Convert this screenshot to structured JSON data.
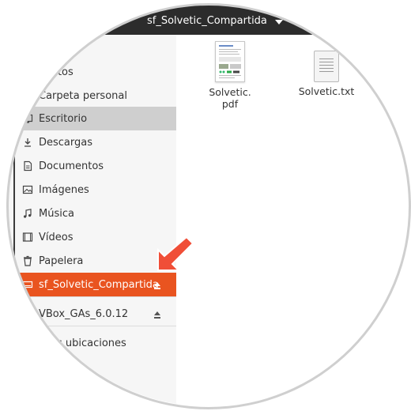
{
  "header": {
    "folder_name": "sf_Solvetic_Compartida"
  },
  "sidebar": {
    "items": [
      {
        "label": "ritos",
        "icon": "star-icon"
      },
      {
        "label": "Carpeta personal",
        "icon": "home-icon"
      },
      {
        "label": "Escritorio",
        "icon": "desktop-icon",
        "state": "active"
      },
      {
        "label": "Descargas",
        "icon": "download-icon"
      },
      {
        "label": "Documentos",
        "icon": "documents-icon"
      },
      {
        "label": "Imágenes",
        "icon": "pictures-icon"
      },
      {
        "label": "Música",
        "icon": "music-icon"
      },
      {
        "label": "Vídeos",
        "icon": "videos-icon"
      },
      {
        "label": "Papelera",
        "icon": "trash-icon"
      },
      {
        "label": "sf_Solvetic_Compartida",
        "icon": "drive-icon",
        "state": "selected"
      },
      {
        "label": "VBox_GAs_6.0.12",
        "icon": "disc-icon"
      },
      {
        "label": "as ubicaciones",
        "icon": "plus-icon"
      }
    ],
    "accent_color": "#e95420",
    "active_color": "#cfcfcf"
  },
  "files": [
    {
      "name_line1": "Solvetic.",
      "name_line2": "pdf",
      "type": "pdf"
    },
    {
      "name_line1": "Solvetic.txt",
      "type": "txt"
    }
  ],
  "annotation": {
    "arrow_color": "#f04e37"
  }
}
